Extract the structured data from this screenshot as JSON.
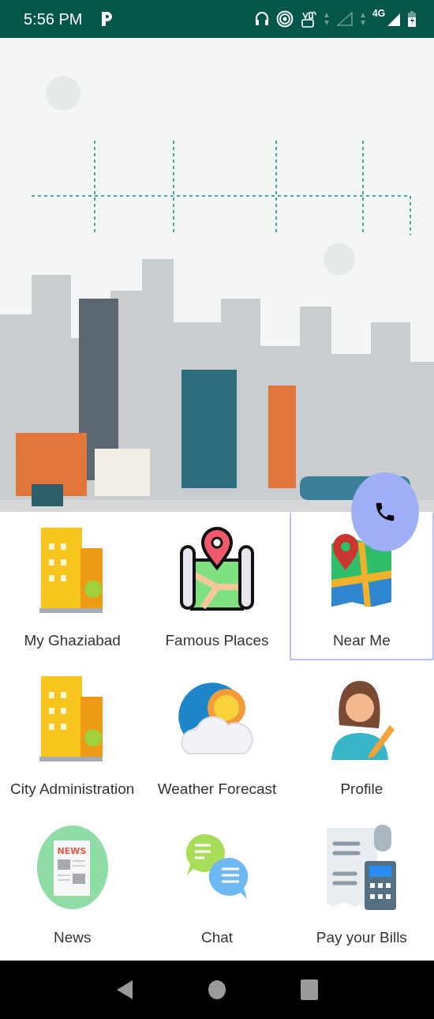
{
  "status_bar": {
    "time": "5:56 PM",
    "network": "4G"
  },
  "tiles": [
    {
      "label": "My Ghaziabad",
      "kind": "building",
      "selected": false
    },
    {
      "label": "Famous Places",
      "kind": "map-scroll",
      "selected": false
    },
    {
      "label": "Near Me",
      "kind": "map-pin",
      "selected": true
    },
    {
      "label": "City Administration",
      "kind": "building",
      "selected": false
    },
    {
      "label": "Weather Forecast",
      "kind": "weather",
      "selected": false
    },
    {
      "label": "Profile",
      "kind": "profile",
      "selected": false
    },
    {
      "label": "News",
      "kind": "news",
      "badge": "NEWS",
      "selected": false
    },
    {
      "label": "Chat",
      "kind": "chat",
      "selected": false
    },
    {
      "label": "Pay your Bills",
      "kind": "bill",
      "selected": false
    }
  ]
}
